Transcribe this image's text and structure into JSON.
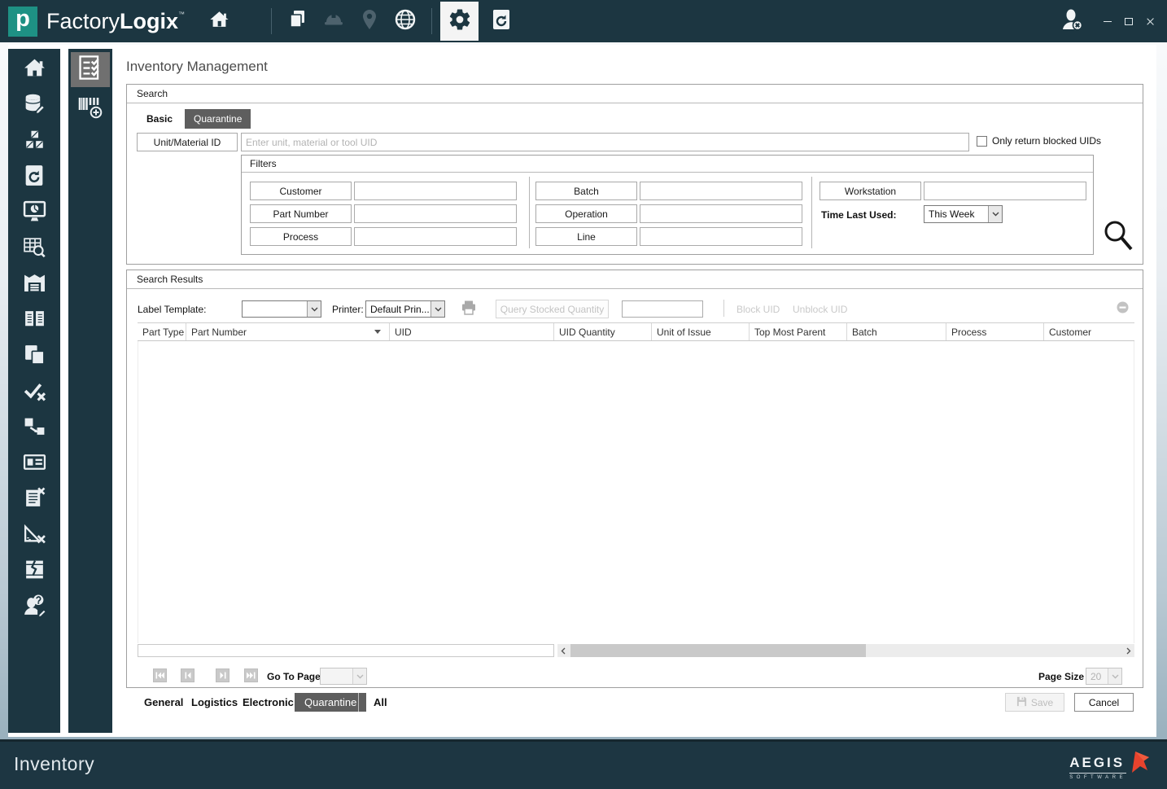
{
  "titlebar": {
    "logo_letter": "p",
    "brand_light": "Factory",
    "brand_bold": "Logix",
    "trademark": "™",
    "icons": [
      "home",
      "documents",
      "hardhat",
      "location-pin",
      "globe",
      "settings-gear",
      "restore-document"
    ],
    "right_icons": [
      "user-logout",
      "minimize",
      "maximize",
      "close"
    ]
  },
  "sidebar": {
    "icons": [
      "home",
      "database-edit",
      "packages",
      "restore-document",
      "dashboard-monitor",
      "table-search",
      "warehouse",
      "book",
      "documents",
      "verify-check",
      "transfer-box",
      "id-card",
      "list-remove",
      "measure-remove",
      "damaged-box",
      "user-question"
    ]
  },
  "subsidebar": {
    "icons": [
      "inventory-checklist",
      "barcode-add"
    ],
    "selected": "inventory-checklist"
  },
  "main": {
    "title": "Inventory Management",
    "search": {
      "label": "Search",
      "tabs": {
        "basic": "Basic",
        "quarantine": "Quarantine"
      },
      "active_tab": "Quarantine",
      "unit_button": "Unit/Material ID",
      "unit_value": "",
      "unit_placeholder": "Enter unit, material or tool UID",
      "blocked_checkbox_label": "Only return blocked UIDs",
      "blocked_checkbox_checked": false,
      "filters": {
        "label": "Filters",
        "col1": [
          "Customer",
          "Part Number",
          "Process"
        ],
        "col2": [
          "Batch",
          "Operation",
          "Line"
        ],
        "workstation_button": "Workstation",
        "time_last_used_label": "Time Last Used:",
        "time_last_used_value": "This Week",
        "field_values": {
          "customer": "",
          "part_number": "",
          "process": "",
          "batch": "",
          "operation": "",
          "line": "",
          "workstation": ""
        }
      }
    },
    "results": {
      "label": "Search Results",
      "label_template_label": "Label Template:",
      "label_template_value": "",
      "printer_label": "Printer:",
      "printer_value": "Default Prin...",
      "query_stocked_button": "Query Stocked Quantity",
      "quantity_value": "",
      "block_uid": "Block UID",
      "unblock_uid": "Unblock UID",
      "columns": [
        "Part Type",
        "Part Number",
        "UID",
        "UID Quantity",
        "Unit of Issue",
        "Top Most Parent",
        "Batch",
        "Process",
        "Customer"
      ],
      "sorted_column": "Part Number",
      "rows": [],
      "go_to_page_label": "Go To Page",
      "go_to_page_value": "",
      "page_size_label": "Page Size",
      "page_size_value": "20"
    },
    "footer_tabs": [
      "General",
      "Logistics",
      "Electronic",
      "Quarantine",
      "All"
    ],
    "active_footer_tab": "Quarantine",
    "save_button": "Save",
    "cancel_button": "Cancel"
  },
  "statusbar": {
    "module": "Inventory",
    "brand": "AEGIS",
    "brand_sub": "SOFTWARE"
  },
  "colors": {
    "chrome_dark": "#1C3641",
    "logo_teal": "#1E9184",
    "active_tab_gray": "#5E5E5E",
    "brand_red": "#E8432D"
  }
}
